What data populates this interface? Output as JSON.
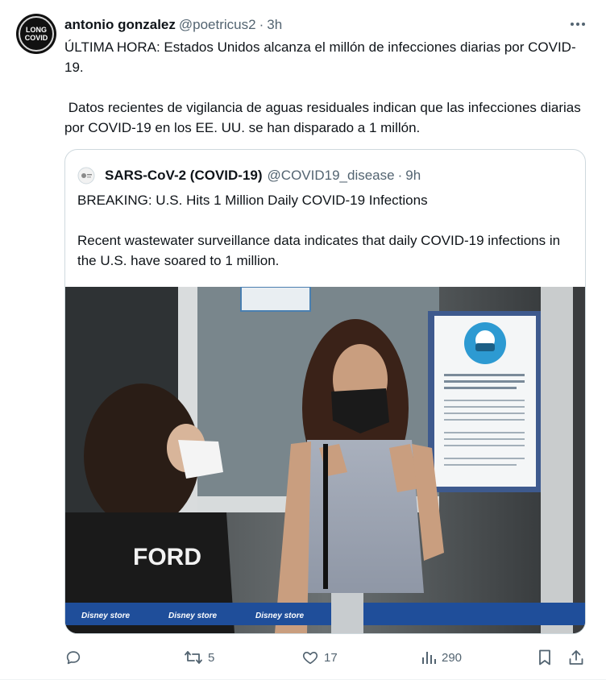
{
  "tweet": {
    "author_name": "antonio gonzalez",
    "author_handle": "@poetricus2",
    "separator": "·",
    "time": "3h",
    "avatar_text": [
      "LONG",
      "COVID"
    ],
    "text_paragraphs": [
      "ÚLTIMA HORA: Estados Unidos alcanza el millón de infecciones diarias por COVID-19.",
      " Datos recientes de vigilancia de aguas residuales indican que las infecciones diarias por COVID-19 en los EE. UU. se han disparado a 1 millón."
    ]
  },
  "quoted_tweet": {
    "author_name": "SARS-CoV-2 (COVID-19)",
    "author_handle": "@COVID19_disease",
    "separator": "·",
    "time": "9h",
    "text_paragraphs": [
      "BREAKING: U.S. Hits 1 Million Daily COVID-19 Infections",
      "Recent wastewater surveillance data indicates that daily COVID-19 infections in the U.S. have soared to 1 million."
    ],
    "photo": {
      "shirt_text": "FORD",
      "barrier_text": [
        "Disney store",
        "Disney store",
        "Disney store"
      ]
    }
  },
  "actions": {
    "reply_count": "",
    "retweet_count": "5",
    "like_count": "17",
    "views_count": "290"
  },
  "colors": {
    "text_primary": "#0f1419",
    "text_secondary": "#536471",
    "border": "#cfd9de"
  },
  "icons": [
    "more-icon",
    "reply-icon",
    "retweet-icon",
    "like-icon",
    "views-icon",
    "bookmark-icon",
    "share-icon"
  ]
}
